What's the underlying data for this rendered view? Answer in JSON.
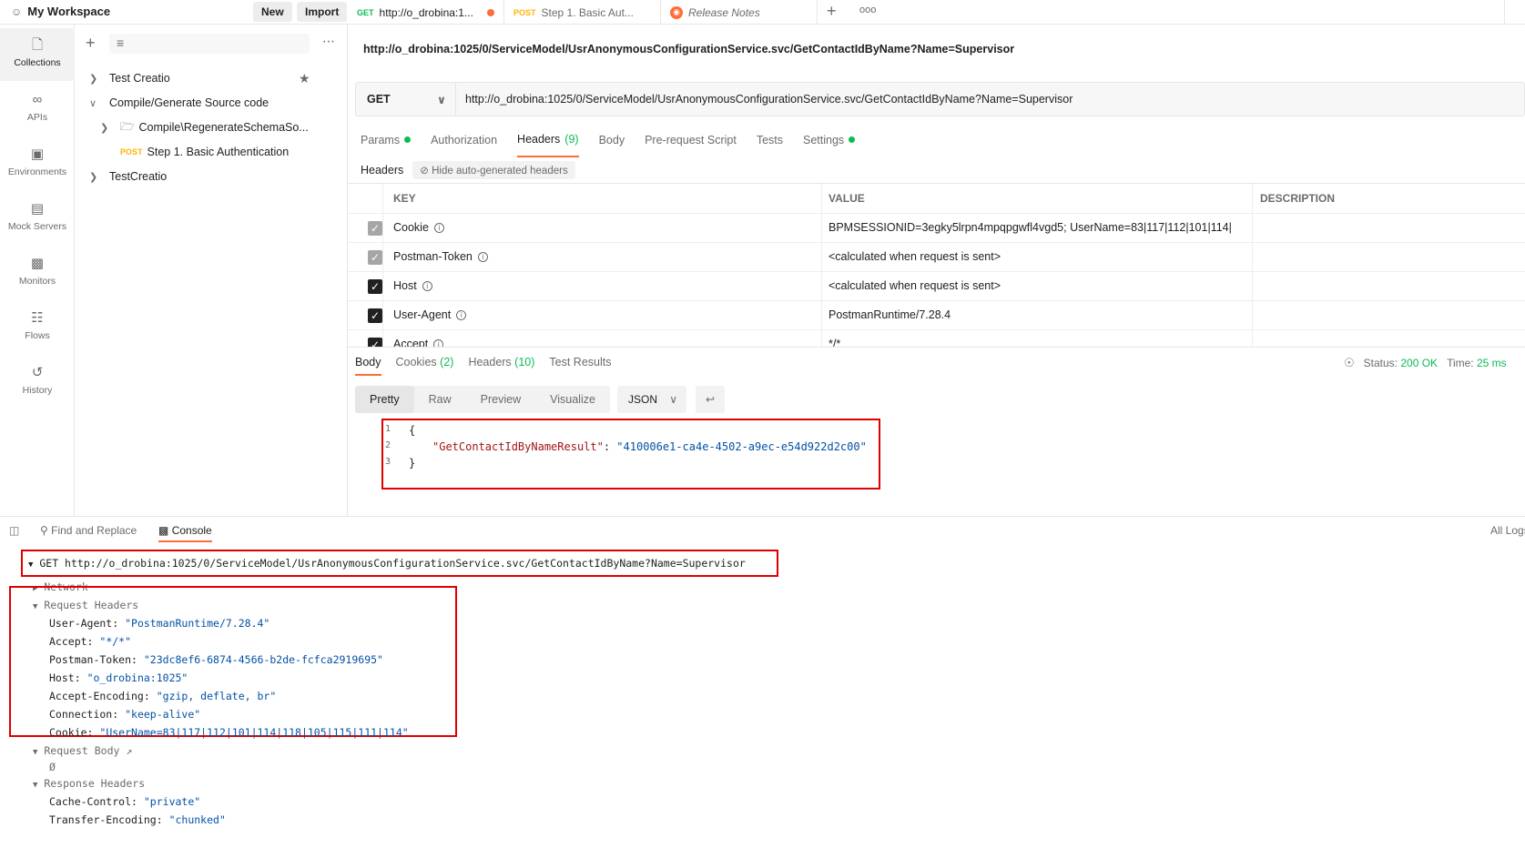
{
  "workspace": {
    "name": "My Workspace",
    "new_label": "New",
    "import_label": "Import"
  },
  "tabs": [
    {
      "method": "GET",
      "label": "http://o_drobina:1...",
      "unsaved": true
    },
    {
      "method": "POST",
      "label": "Step 1. Basic Aut..."
    },
    {
      "label": "Release Notes"
    }
  ],
  "tab_extras": {
    "add": "+",
    "more": "ooo"
  },
  "rail": [
    {
      "label": "Collections",
      "icon": "collections-icon"
    },
    {
      "label": "APIs",
      "icon": "apis-icon"
    },
    {
      "label": "Environments",
      "icon": "environments-icon"
    },
    {
      "label": "Mock Servers",
      "icon": "mock-servers-icon"
    },
    {
      "label": "Monitors",
      "icon": "monitors-icon"
    },
    {
      "label": "Flows",
      "icon": "flows-icon"
    },
    {
      "label": "History",
      "icon": "history-icon"
    }
  ],
  "sidebar": {
    "items": [
      {
        "label": "Test Creatio",
        "starred": true
      },
      {
        "label": "Compile/Generate Source code",
        "expanded": true
      },
      {
        "label": "Compile\\RegenerateSchemaSo..."
      },
      {
        "method": "POST",
        "label": "Step 1. Basic Authentication"
      },
      {
        "label": "TestCreatio"
      }
    ]
  },
  "request": {
    "title": "http://o_drobina:1025/0/ServiceModel/UsrAnonymousConfigurationService.svc/GetContactIdByName?Name=Supervisor",
    "method": "GET",
    "url": "http://o_drobina:1025/0/ServiceModel/UsrAnonymousConfigurationService.svc/GetContactIdByName?Name=Supervisor",
    "tabs": [
      {
        "label": "Params",
        "dot": true
      },
      {
        "label": "Authorization"
      },
      {
        "label": "Headers",
        "count": "(9)",
        "active": true
      },
      {
        "label": "Body"
      },
      {
        "label": "Pre-request Script"
      },
      {
        "label": "Tests"
      },
      {
        "label": "Settings",
        "dot": true
      }
    ],
    "headers_label": "Headers",
    "hide_auto_label": "Hide auto-generated headers",
    "columns": {
      "key": "KEY",
      "value": "VALUE",
      "description": "DESCRIPTION"
    },
    "headers": [
      {
        "key": "Cookie",
        "value": "BPMSESSIONID=3egky5lrpn4mpqpgwfl4vgd5; UserName=83|117|112|101|114|",
        "checked": "gray"
      },
      {
        "key": "Postman-Token",
        "value": "<calculated when request is sent>",
        "checked": "gray"
      },
      {
        "key": "Host",
        "value": "<calculated when request is sent>",
        "checked": "dark"
      },
      {
        "key": "User-Agent",
        "value": "PostmanRuntime/7.28.4",
        "checked": "dark"
      },
      {
        "key": "Accept",
        "value": "*/*",
        "checked": "dark"
      }
    ]
  },
  "response": {
    "tabs": [
      {
        "label": "Body",
        "active": true
      },
      {
        "label": "Cookies",
        "count": "(2)"
      },
      {
        "label": "Headers",
        "count": "(10)"
      },
      {
        "label": "Test Results"
      }
    ],
    "status_label": "Status:",
    "status_value": "200 OK",
    "time_label": "Time:",
    "time_value": "25 ms",
    "views": [
      "Pretty",
      "Raw",
      "Preview",
      "Visualize"
    ],
    "format": "JSON",
    "json_key": "\"GetContactIdByNameResult\"",
    "json_value": "\"410006e1-ca4e-4502-a9ec-e54d922d2c00\"",
    "brace_open": "{",
    "brace_close": "}",
    "line_numbers": [
      "1",
      "2",
      "3"
    ]
  },
  "console": {
    "find_label": "Find and Replace",
    "console_label": "Console",
    "all_logs": "All Logs",
    "get_line": "GET http://o_drobina:1025/0/ServiceModel/UsrAnonymousConfigurationService.svc/GetContactIdByName?Name=Supervisor",
    "network": "Network",
    "request_headers": "Request Headers",
    "req_headers": [
      {
        "key": "User-Agent:",
        "value": "\"PostmanRuntime/7.28.4\""
      },
      {
        "key": "Accept:",
        "value": "\"*/*\""
      },
      {
        "key": "Postman-Token:",
        "value": "\"23dc8ef6-6874-4566-b2de-fcfca2919695\""
      },
      {
        "key": "Host:",
        "value": "\"o_drobina:1025\""
      },
      {
        "key": "Accept-Encoding:",
        "value": "\"gzip, deflate, br\""
      },
      {
        "key": "Connection:",
        "value": "\"keep-alive\""
      },
      {
        "key": "Cookie:",
        "value": "\"UserName=83|117|112|101|114|118|105|115|111|114\""
      }
    ],
    "request_body": "Request Body",
    "request_body_value": "Ø",
    "response_headers": "Response Headers",
    "resp_headers": [
      {
        "key": "Cache-Control:",
        "value": "\"private\""
      },
      {
        "key": "Transfer-Encoding:",
        "value": "\"chunked\""
      }
    ]
  },
  "colors": {
    "accent": "#ff6c37",
    "get": "#0cbb52",
    "post": "#ffb400",
    "highlight": "#e00000"
  }
}
